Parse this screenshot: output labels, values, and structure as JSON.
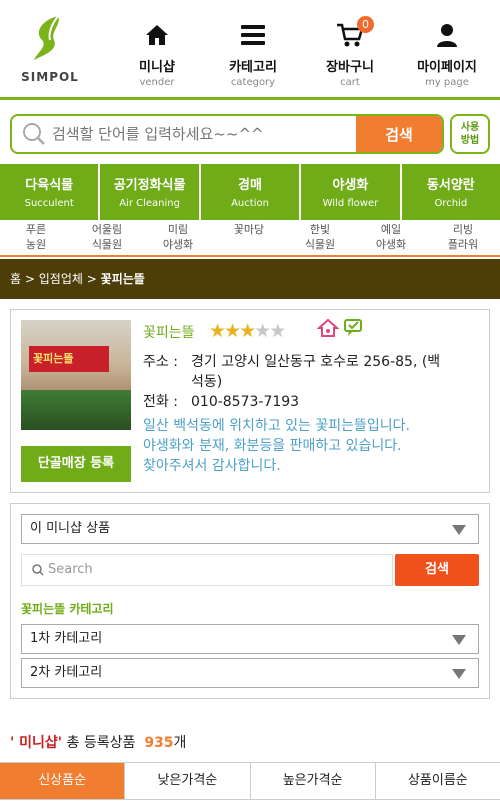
{
  "logo": {
    "text": "SIMPOL"
  },
  "nav": [
    {
      "label": "미니샵",
      "sub": "vender",
      "icon": "home-icon"
    },
    {
      "label": "카테고리",
      "sub": "category",
      "icon": "menu-icon"
    },
    {
      "label": "장바구니",
      "sub": "cart",
      "icon": "cart-icon",
      "badge": "0"
    },
    {
      "label": "마이페이지",
      "sub": "my page",
      "icon": "user-icon"
    }
  ],
  "search": {
    "placeholder": "검색할 단어를 입력하세요~~^^",
    "button": "검색",
    "howto_line1": "사용",
    "howto_line2": "방법"
  },
  "categories": [
    {
      "ko": "다육식물",
      "en": "Succulent"
    },
    {
      "ko": "공기정화식물",
      "en": "Air Cleaning"
    },
    {
      "ko": "경매",
      "en": "Auction"
    },
    {
      "ko": "야생화",
      "en": "Wild flower"
    },
    {
      "ko": "동서양란",
      "en": "Orchid"
    }
  ],
  "sublinks": [
    {
      "line1": "푸른",
      "line2": "농원"
    },
    {
      "line1": "어울림",
      "line2": "식물원"
    },
    {
      "line1": "미림",
      "line2": "야생화"
    },
    {
      "line1": "꽃마당",
      "line2": ""
    },
    {
      "line1": "한빛",
      "line2": "식물원"
    },
    {
      "line1": "예일",
      "line2": "야생화"
    },
    {
      "line1": "리빙",
      "line2": "플라워"
    }
  ],
  "breadcrumb": {
    "home": "홈",
    "sep": ">",
    "section": "입점업체",
    "current": "꽃피는뜰"
  },
  "shop": {
    "name": "꽃피는뜰",
    "rating": 3,
    "rating_max": 5,
    "address_label": "주소 :",
    "address_line1": "경기 고양시 일산동구 호수로 256-85, (백",
    "address_line2": "석동)",
    "phone_label": "전화 :",
    "phone": "010-8573-7193",
    "description_line1": "일산 백석동에 위치하고 있는 꽃피는뜰입니다.",
    "description_line2": "야생화와 분재, 화분등을 판매하고 있습니다.",
    "description_line3": "찾아주셔서 감사합니다.",
    "register_button": "단골매장 등록",
    "sign_text": "꽃피는뜰"
  },
  "filter": {
    "scope_select": "이 미니샵 상품",
    "search_placeholder": "Search",
    "search_button": "검색",
    "category_title": "꽃피는뜰 카테고리",
    "cat1_select": "1차 카테고리",
    "cat2_select": "2차 카테고리"
  },
  "total": {
    "mini": "' 미니샵'",
    "label": "총 등록상품",
    "count": "935",
    "unit": "개"
  },
  "sorts": [
    {
      "label": "신상품순",
      "active": true
    },
    {
      "label": "낮은가격순",
      "active": false
    },
    {
      "label": "높은가격순",
      "active": false
    },
    {
      "label": "상품이름순",
      "active": false
    }
  ],
  "colors": {
    "brand_green": "#6fac18",
    "accent_orange": "#f07d30",
    "breadcrumb_bg": "#4d3d08",
    "star": "#e6b421"
  }
}
